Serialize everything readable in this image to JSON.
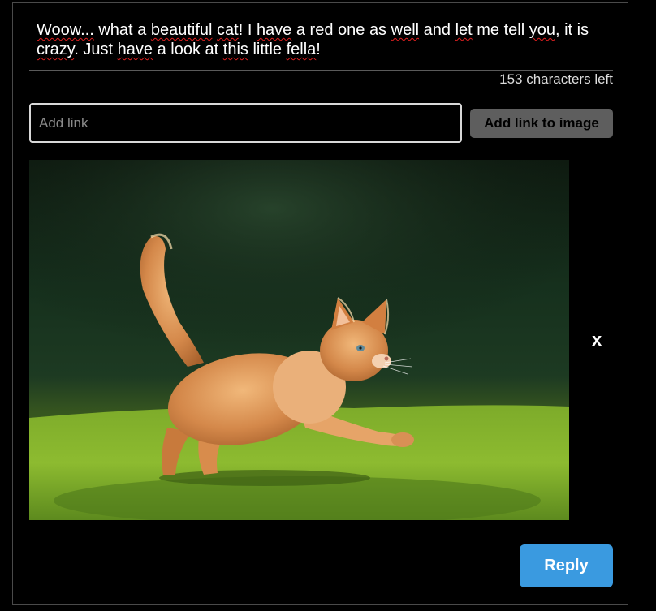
{
  "comment": {
    "segments": [
      {
        "text": "Woow...",
        "spell": true
      },
      {
        "text": " what a ",
        "spell": false
      },
      {
        "text": "beautiful",
        "spell": true
      },
      {
        "text": " ",
        "spell": false
      },
      {
        "text": "cat",
        "spell": true
      },
      {
        "text": "! I ",
        "spell": false
      },
      {
        "text": "have",
        "spell": true
      },
      {
        "text": " a red one as ",
        "spell": false
      },
      {
        "text": "well",
        "spell": true
      },
      {
        "text": " and ",
        "spell": false
      },
      {
        "text": "let",
        "spell": true
      },
      {
        "text": " me tell ",
        "spell": false
      },
      {
        "text": "you",
        "spell": true
      },
      {
        "text": ", it is ",
        "spell": false
      },
      {
        "text": "crazy",
        "spell": true
      },
      {
        "text": ". Just ",
        "spell": false
      },
      {
        "text": "have",
        "spell": true
      },
      {
        "text": " a look at ",
        "spell": false
      },
      {
        "text": "this",
        "spell": true
      },
      {
        "text": " little ",
        "spell": false
      },
      {
        "text": "fella",
        "spell": true
      },
      {
        "text": "!",
        "spell": false
      }
    ],
    "characters_left": "153 characters left"
  },
  "link": {
    "placeholder": "Add link",
    "value": "",
    "add_button_label": "Add link to image"
  },
  "attachment": {
    "remove_label": "x"
  },
  "actions": {
    "reply_label": "Reply"
  },
  "colors": {
    "reply_button": "#3a9ae0",
    "add_link_button": "#5e5e5e",
    "spell_underline": "#e02020"
  }
}
